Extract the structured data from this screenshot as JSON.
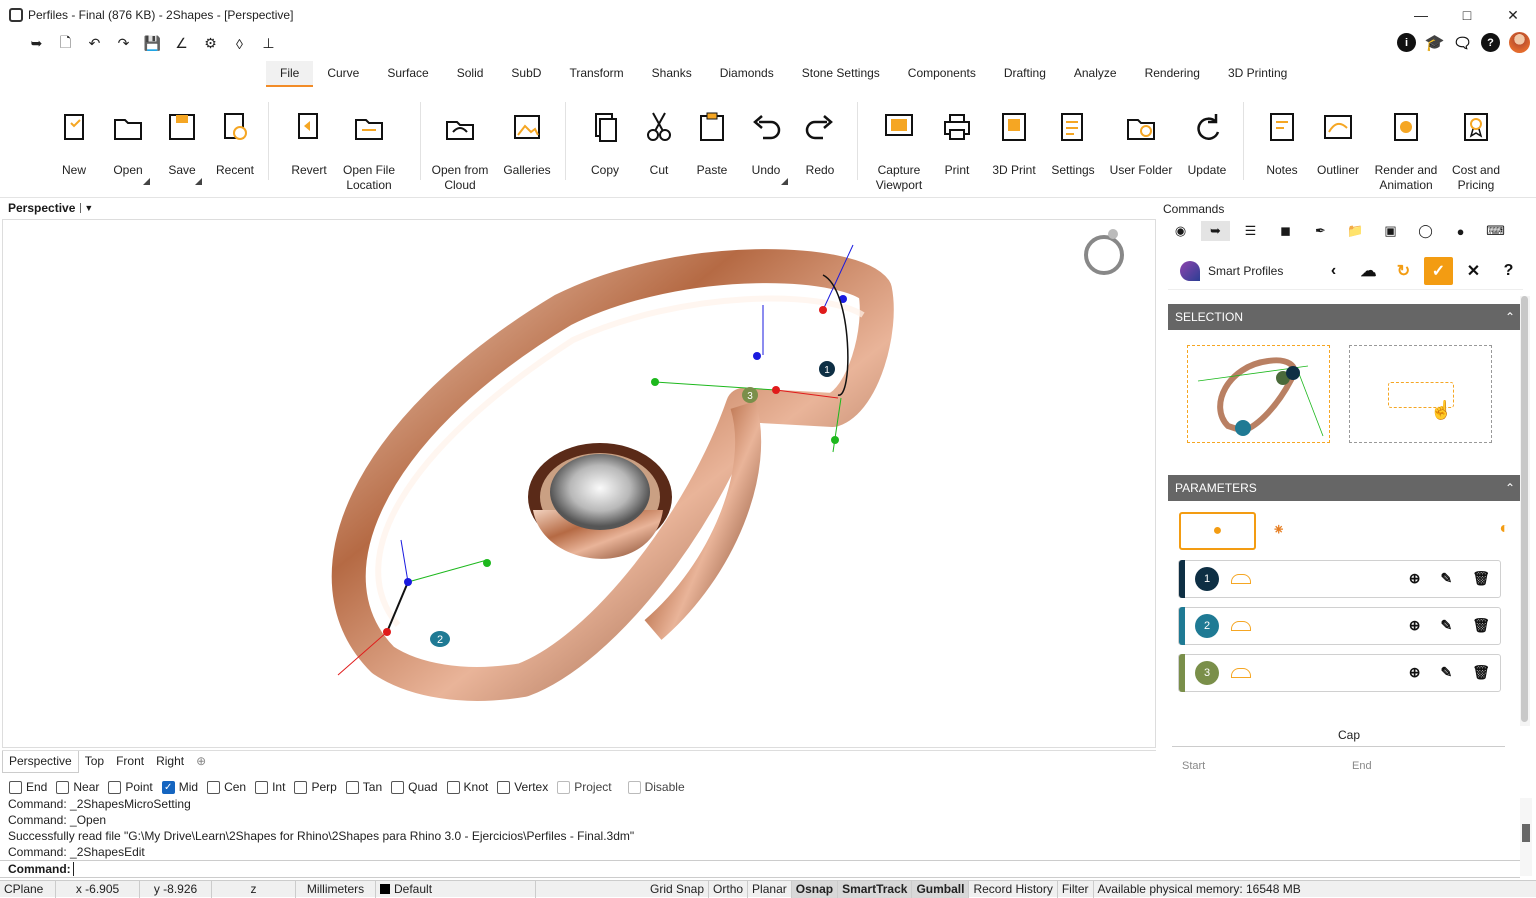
{
  "window": {
    "title": "Perfiles - Final (876 KB) - 2Shapes - [Perspective]"
  },
  "menu_tabs": [
    "File",
    "Curve",
    "Surface",
    "Solid",
    "SubD",
    "Transform",
    "Shanks",
    "Diamonds",
    "Stone Settings",
    "Components",
    "Drafting",
    "Analyze",
    "Rendering",
    "3D Printing"
  ],
  "active_tab": "File",
  "ribbon": [
    {
      "label": "New"
    },
    {
      "label": "Open"
    },
    {
      "label": "Save"
    },
    {
      "label": "Recent"
    },
    {
      "label": "Revert"
    },
    {
      "label": "Open File Location"
    },
    {
      "label": "Open from Cloud"
    },
    {
      "label": "Galleries"
    },
    {
      "label": "Copy"
    },
    {
      "label": "Cut"
    },
    {
      "label": "Paste"
    },
    {
      "label": "Undo"
    },
    {
      "label": "Redo"
    },
    {
      "label": "Capture Viewport"
    },
    {
      "label": "Print"
    },
    {
      "label": "3D Print"
    },
    {
      "label": "Settings"
    },
    {
      "label": "User Folder"
    },
    {
      "label": "Update"
    },
    {
      "label": "Notes"
    },
    {
      "label": "Outliner"
    },
    {
      "label": "Render and Animation"
    },
    {
      "label": "Cost and Pricing"
    }
  ],
  "viewport": {
    "label": "Perspective",
    "markers": [
      "1",
      "2",
      "3"
    ]
  },
  "viewport_tabs": [
    "Perspective",
    "Top",
    "Front",
    "Right"
  ],
  "osnaps": [
    {
      "label": "End",
      "checked": false
    },
    {
      "label": "Near",
      "checked": false
    },
    {
      "label": "Point",
      "checked": false
    },
    {
      "label": "Mid",
      "checked": true
    },
    {
      "label": "Cen",
      "checked": false
    },
    {
      "label": "Int",
      "checked": false
    },
    {
      "label": "Perp",
      "checked": false
    },
    {
      "label": "Tan",
      "checked": false
    },
    {
      "label": "Quad",
      "checked": false
    },
    {
      "label": "Knot",
      "checked": false
    },
    {
      "label": "Vertex",
      "checked": false
    },
    {
      "label": "Project",
      "checked": false
    },
    {
      "label": "Disable",
      "checked": false
    }
  ],
  "command_history": [
    "Command: _2ShapesMicroSetting",
    "Command: _Open",
    "Successfully read file \"G:\\My Drive\\Learn\\2Shapes for Rhino\\2Shapes para Rhino 3.0 - Ejercicios\\Perfiles - Final.3dm\"",
    "Command: _2ShapesEdit"
  ],
  "command_prompt": "Command:",
  "status": {
    "cplane": "CPlane",
    "x": "x -6.905",
    "y": "y -8.926",
    "z": "z",
    "units": "Millimeters",
    "layer": "Default",
    "toggles": [
      "Grid Snap",
      "Ortho",
      "Planar",
      "Osnap",
      "SmartTrack",
      "Gumball",
      "Record History",
      "Filter"
    ],
    "active_toggles": [
      "Osnap",
      "SmartTrack",
      "Gumball"
    ],
    "memory": "Available physical memory: 16548 MB"
  },
  "panel": {
    "title": "Commands",
    "plugin_name": "Smart Profiles",
    "selection_header": "SELECTION",
    "parameters_header": "PARAMETERS",
    "profiles": [
      {
        "num": "1",
        "color": "#0e2f44"
      },
      {
        "num": "2",
        "color": "#1f7a94"
      },
      {
        "num": "3",
        "color": "#7a8f4a"
      }
    ],
    "cap_label": "Cap",
    "start_label": "Start",
    "end_label": "End"
  },
  "colors": {
    "accent": "#f39c12",
    "ring": "#c8835e",
    "header": "#666666"
  }
}
